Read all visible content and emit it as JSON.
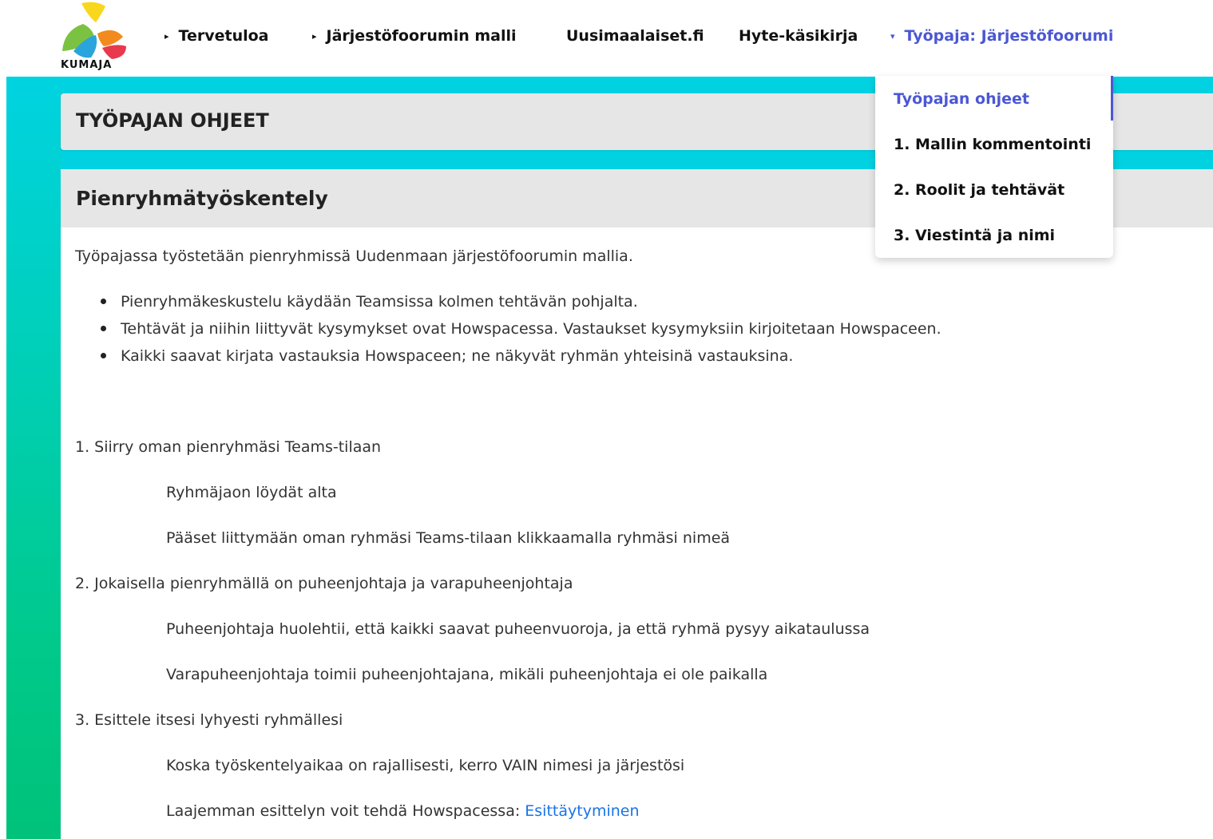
{
  "brand": {
    "logo_text": "KUMAJA"
  },
  "nav": {
    "items": [
      {
        "label": "Tervetuloa",
        "caret": "▸"
      },
      {
        "label": "Järjestöfoorumin malli",
        "caret": "▸"
      },
      {
        "label": "Uusimaalaiset.fi"
      },
      {
        "label": "Hyte-käsikirja"
      },
      {
        "label": "Työpaja: Järjestöfoorumi",
        "caret": "▾",
        "active": true
      }
    ]
  },
  "dropdown": {
    "items": [
      {
        "label": "Työpajan ohjeet",
        "active": true
      },
      {
        "label": "1. Mallin kommentointi"
      },
      {
        "label": "2. Roolit ja tehtävät"
      },
      {
        "label": "3. Viestintä ja nimi"
      }
    ]
  },
  "page": {
    "title": "TYÖPAJAN OHJEET"
  },
  "section": {
    "heading": "Pienryhmätyöskentely",
    "intro": "Työpajassa työstetään pienryhmissä Uudenmaan järjestöfoorumin mallia.",
    "bullets": [
      "Pienryhmäkeskustelu käydään Teamsissa kolmen tehtävän pohjalta.",
      "Tehtävät ja niihin liittyvät kysymykset ovat Howspacessa. Vastaukset kysymyksiin kirjoitetaan Howspaceen.",
      "Kaikki saavat kirjata vastauksia Howspaceen; ne näkyvät ryhmän yhteisinä vastauksina."
    ],
    "steps": [
      {
        "text": "1. Siirry oman pienryhmäsi Teams-tilaan"
      },
      {
        "text": "Ryhmäjaon löydät alta",
        "indent": true
      },
      {
        "text": "Pääset liittymään oman ryhmäsi Teams-tilaan klikkaamalla ryhmäsi nimeä",
        "indent": true
      },
      {
        "text": "2. Jokaisella pienryhmällä on puheenjohtaja ja varapuheenjohtaja"
      },
      {
        "text": "Puheenjohtaja huolehtii, että kaikki saavat puheenvuoroja, ja että ryhmä pysyy aikataulussa",
        "indent": true
      },
      {
        "text": "Varapuheenjohtaja toimii puheenjohtajana, mikäli puheenjohtaja ei ole paikalla",
        "indent": true
      },
      {
        "text": "3. Esittele itsesi lyhyesti ryhmällesi"
      },
      {
        "text": "Koska työskentelyaikaa on rajallisesti, kerro VAIN nimesi ja järjestösi",
        "indent": true
      },
      {
        "text": "Laajemman esittelyn voit tehdä Howspacessa: ",
        "link": "Esittäytyminen",
        "indent": true
      }
    ]
  },
  "colors": {
    "accent": "#4b57d3",
    "link": "#1a73e8",
    "band": "#00d2e2",
    "strip_bottom": "#00c27a",
    "card_header": "#e6e6e6"
  }
}
